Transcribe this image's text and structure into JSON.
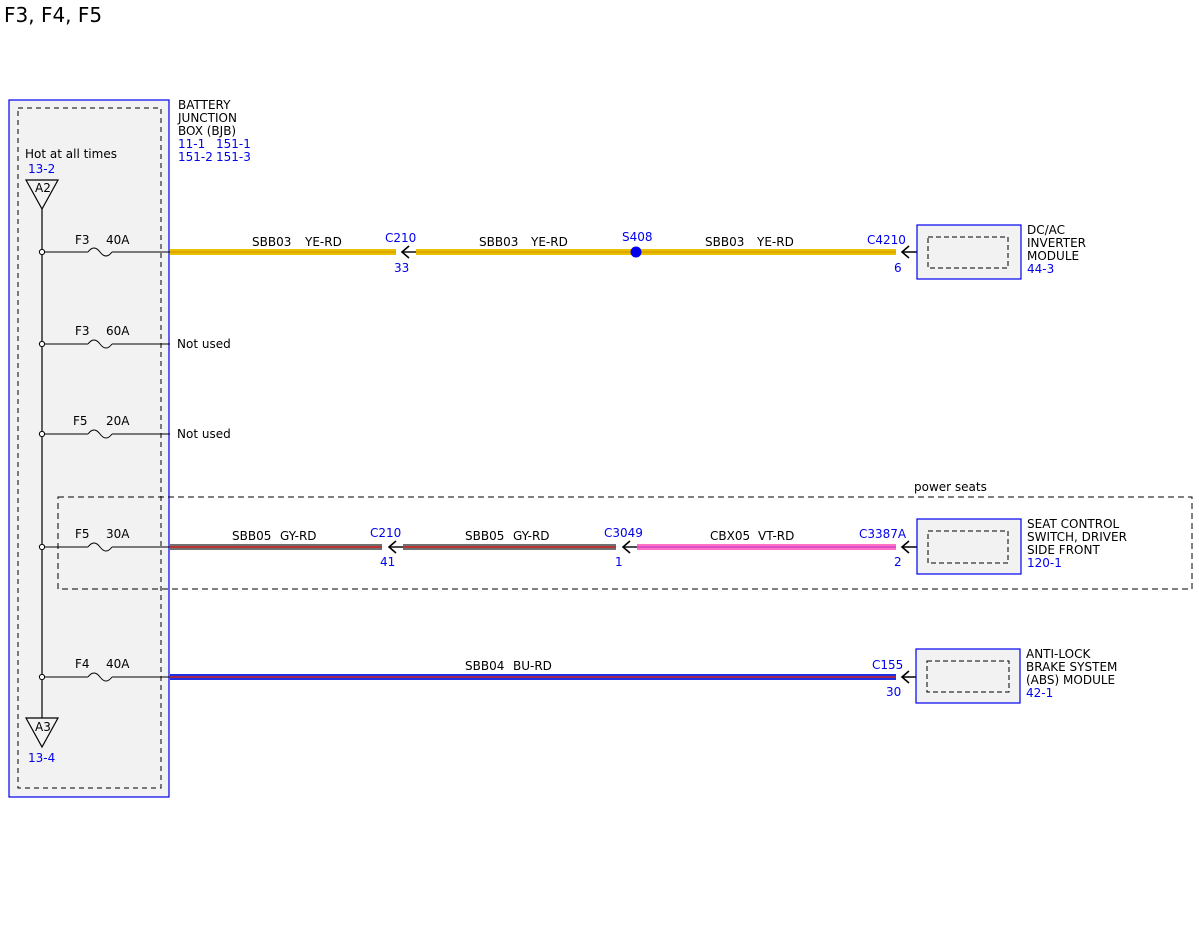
{
  "page_title": "F3, F4, F5",
  "colors": {
    "blue_ref": "#0000ee",
    "box_fill": "#f2f2f2",
    "yellow": "#e8c000",
    "orange": "#d9a000",
    "gray": "#707070",
    "red": "#d02020",
    "pink": "#ff6ec7",
    "violet": "#c040c0",
    "blue_wire": "#2030e0"
  },
  "bjb": {
    "name_lines": [
      "BATTERY",
      "JUNCTION",
      "BOX (BJB)"
    ],
    "refs_row1": [
      "11-1",
      "151-1"
    ],
    "refs_row2": [
      "151-2",
      "151-3"
    ],
    "hot_label": "Hot at all times",
    "top_ref": "13-2",
    "top_connector": "A2",
    "bottom_connector": "A3",
    "bottom_ref": "13-4"
  },
  "fuses": [
    {
      "id": "F3",
      "rating": "40A"
    },
    {
      "id": "F3",
      "rating": "60A"
    },
    {
      "id": "F5",
      "rating": "20A"
    },
    {
      "id": "F5",
      "rating": "30A"
    },
    {
      "id": "F4",
      "rating": "40A"
    }
  ],
  "not_used": [
    "Not used",
    "Not used"
  ],
  "circuit1": {
    "wires": [
      {
        "circuit": "SBB03",
        "color": "YE-RD"
      },
      {
        "circuit": "SBB03",
        "color": "YE-RD"
      },
      {
        "circuit": "SBB03",
        "color": "YE-RD"
      }
    ],
    "conn1": {
      "name": "C210",
      "pin": "33"
    },
    "splice": "S408",
    "conn2": {
      "name": "C4210",
      "pin": "6"
    },
    "module": {
      "lines": [
        "DC/AC",
        "INVERTER",
        "MODULE"
      ],
      "ref": "44-3"
    }
  },
  "power_seats_label": "power seats",
  "circuit4": {
    "wires": [
      {
        "circuit": "SBB05",
        "color": "GY-RD"
      },
      {
        "circuit": "SBB05",
        "color": "GY-RD"
      },
      {
        "circuit": "CBX05",
        "color": "VT-RD"
      }
    ],
    "conn1": {
      "name": "C210",
      "pin": "41"
    },
    "conn2": {
      "name": "C3049",
      "pin": "1"
    },
    "conn3": {
      "name": "C3387A",
      "pin": "2"
    },
    "module": {
      "lines": [
        "SEAT CONTROL",
        "SWITCH, DRIVER",
        "SIDE FRONT"
      ],
      "ref": "120-1"
    }
  },
  "circuit5": {
    "wire": {
      "circuit": "SBB04",
      "color": "BU-RD"
    },
    "conn": {
      "name": "C155",
      "pin": "30"
    },
    "module": {
      "lines": [
        "ANTI-LOCK",
        "BRAKE SYSTEM",
        "(ABS) MODULE"
      ],
      "ref": "42-1"
    }
  }
}
